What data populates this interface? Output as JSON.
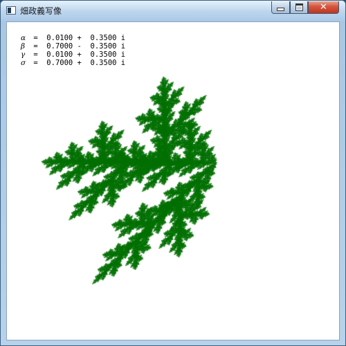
{
  "window": {
    "title": "畑政義写像"
  },
  "controls": {
    "minimize_icon": "minimize-icon",
    "maximize_icon": "maximize-icon",
    "close_label": "✕"
  },
  "params": [
    {
      "symbol": "α",
      "sep": " =  ",
      "re": "0.0100",
      "op": " +  ",
      "im": "0.3500",
      "unit": " i"
    },
    {
      "symbol": "β",
      "sep": " =  ",
      "re": "0.7000",
      "op": " -  ",
      "im": "0.3500",
      "unit": " i"
    },
    {
      "symbol": "γ",
      "sep": " =  ",
      "re": "0.0100",
      "op": " +  ",
      "im": "0.3500",
      "unit": " i"
    },
    {
      "symbol": "σ",
      "sep": " =  ",
      "re": "0.7000",
      "op": " +  ",
      "im": "0.3500",
      "unit": " i"
    }
  ],
  "fractal": {
    "color": "#007000",
    "alpha_re": 0.01,
    "alpha_im": 0.35,
    "beta_re": 0.7,
    "beta_im": -0.35,
    "gamma_re": 0.01,
    "gamma_im": 0.35,
    "delta_re": 0.7,
    "delta_im": 0.35
  }
}
